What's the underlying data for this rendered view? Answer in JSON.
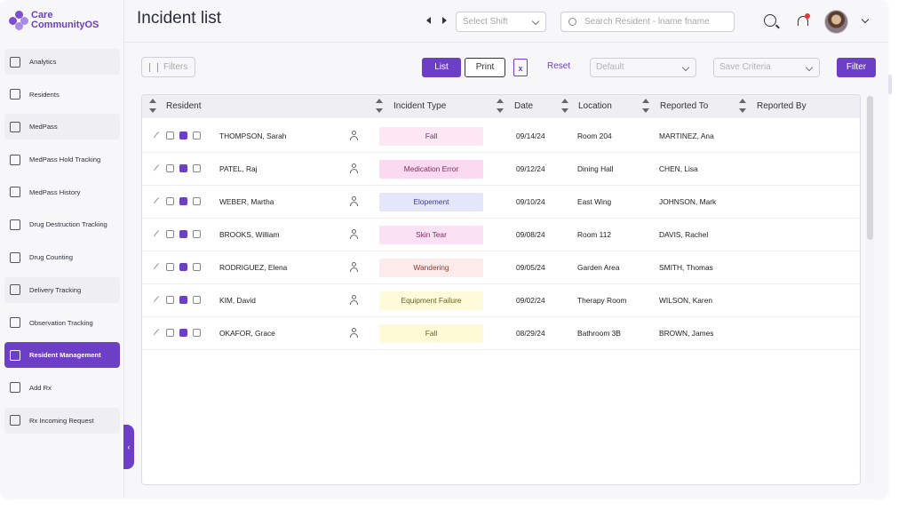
{
  "app": {
    "brand_line1": "Care",
    "brand_line2": "CommunityOS"
  },
  "sidebar": {
    "items": [
      {
        "label": "Analytics",
        "icon": "analytics-icon",
        "state": "shaded"
      },
      {
        "label": "Residents",
        "icon": "residents-icon",
        "state": ""
      },
      {
        "label": "MedPass",
        "icon": "medpass-icon",
        "state": "shaded"
      },
      {
        "label": "MedPass Hold Tracking",
        "icon": "hold-tracking-icon",
        "state": ""
      },
      {
        "label": "MedPass History",
        "icon": "history-icon",
        "state": ""
      },
      {
        "label": "Drug Destruction Tracking",
        "icon": "pill-icon",
        "state": ""
      },
      {
        "label": "Drug Counting",
        "icon": "tag-icon",
        "state": ""
      },
      {
        "label": "Delivery Tracking",
        "icon": "truck-icon",
        "state": "shaded"
      },
      {
        "label": "Observation Tracking",
        "icon": "observation-icon",
        "state": ""
      },
      {
        "label": "Resident Management",
        "icon": "resident-management-icon",
        "state": "active"
      },
      {
        "label": "Add Rx",
        "icon": "add-rx-icon",
        "state": ""
      },
      {
        "label": "Rx Incoming Request",
        "icon": "rx-request-icon",
        "state": "shaded"
      }
    ],
    "collapse_glyph": "‹"
  },
  "header": {
    "title": "Incident list",
    "shift_placeholder": "Select Shift",
    "search_placeholder": "Search Resident - lname fname"
  },
  "toolbar": {
    "filters_label": "Filters",
    "list_label": "List",
    "print_label": "Print",
    "excel_glyph": "x",
    "reset_label": "Reset",
    "default_placeholder": "Default",
    "criteria_placeholder": "Save Criteria",
    "filter_label": "Filter"
  },
  "table": {
    "columns": [
      "Resident",
      "Incident Type",
      "Date",
      "Location",
      "Reported To",
      "Reported By"
    ],
    "rows": [
      {
        "resident": "THOMPSON, Sarah",
        "type": "Fall",
        "date": "09/14/24",
        "location": "Room 204",
        "reported_to": "MARTINEZ, Ana",
        "reported_by": "",
        "badge_bg": "#fde7f5",
        "badge_fg": "#7a2d5e"
      },
      {
        "resident": "PATEL, Raj",
        "type": "Medication Error",
        "date": "09/12/24",
        "location": "Dining Hall",
        "reported_to": "CHEN, Lisa",
        "reported_by": "",
        "badge_bg": "#fbd9f1",
        "badge_fg": "#7a2d5e"
      },
      {
        "resident": "WEBER, Martha",
        "type": "Elopement",
        "date": "09/10/24",
        "location": "East Wing",
        "reported_to": "JOHNSON, Mark",
        "reported_by": "",
        "badge_bg": "#e6e6fb",
        "badge_fg": "#3b3b9a"
      },
      {
        "resident": "BROOKS, William",
        "type": "Skin Tear",
        "date": "09/08/24",
        "location": "Room 112",
        "reported_to": "DAVIS, Rachel",
        "reported_by": "",
        "badge_bg": "#fbe1f4",
        "badge_fg": "#7a2d5e"
      },
      {
        "resident": "RODRIGUEZ, Elena",
        "type": "Wandering",
        "date": "09/05/24",
        "location": "Garden Area",
        "reported_to": "SMITH, Thomas",
        "reported_by": "",
        "badge_bg": "#fdeaea",
        "badge_fg": "#8a3a30"
      },
      {
        "resident": "KIM, David",
        "type": "Equipment Failure",
        "date": "09/02/24",
        "location": "Therapy Room",
        "reported_to": "WILSON, Karen",
        "reported_by": "",
        "badge_bg": "#fdfbd9",
        "badge_fg": "#6b6220"
      },
      {
        "resident": "OKAFOR, Grace",
        "type": "Fall",
        "date": "08/29/24",
        "location": "Bathroom 3B",
        "reported_to": "BROWN, James",
        "reported_by": "",
        "badge_bg": "#fdfad6",
        "badge_fg": "#6b6220"
      }
    ]
  },
  "colors": {
    "accent": "#6c3fc6"
  }
}
